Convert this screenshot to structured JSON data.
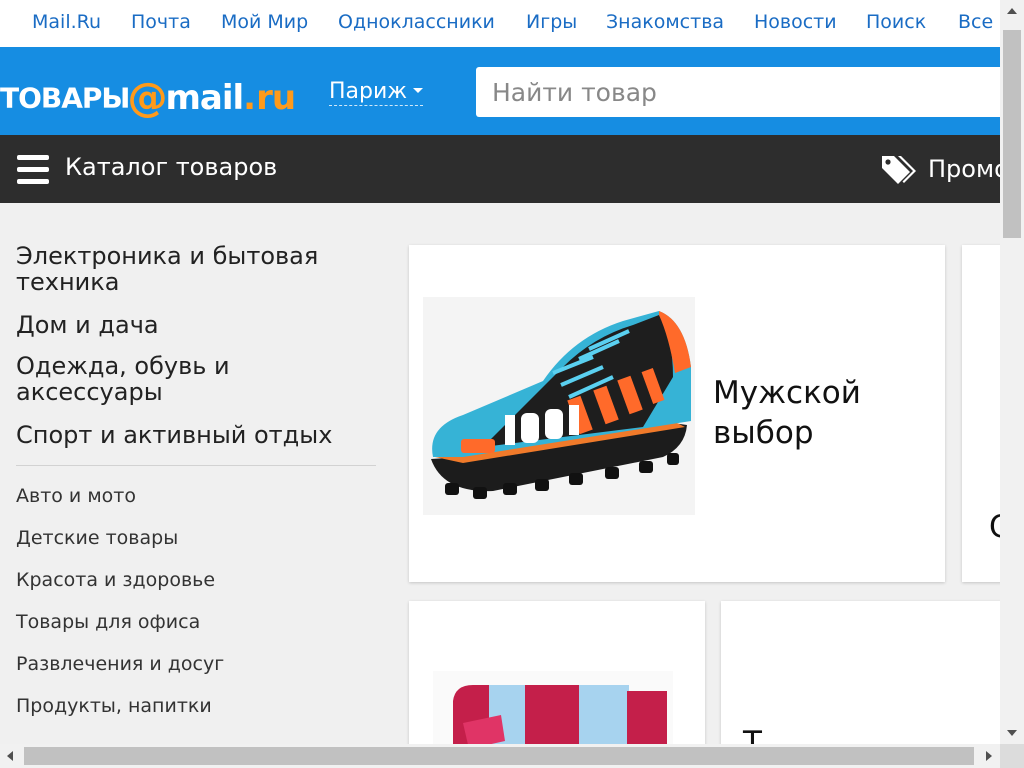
{
  "topnav": {
    "items": [
      "Mail.Ru",
      "Почта",
      "Мой Мир",
      "Одноклассники",
      "Игры",
      "Знакомства",
      "Новости",
      "Поиск",
      "Все"
    ]
  },
  "header": {
    "logo_part1": "ТОВАРЫ",
    "logo_at": "@",
    "logo_part2": "mail",
    "logo_dot": ".",
    "logo_part3": "ru",
    "city": "Париж",
    "search_placeholder": "Найти товар"
  },
  "catbar": {
    "title": "Каталог товаров",
    "promo": "Промо"
  },
  "sidebar": {
    "main_categories": [
      "Электроника и бытовая техника",
      "Дом и дача",
      "Одежда, обувь и аксессуары",
      "Спорт и активный отдых"
    ],
    "sub_categories": [
      "Авто и мото",
      "Детские товары",
      "Красота и здоровье",
      "Товары для офиса",
      "Развлечения и досуг",
      "Продукты, напитки"
    ]
  },
  "cards": {
    "card1_title": "Мужской выбор",
    "card2_partial": "С",
    "card4_partial": "Т"
  },
  "colors": {
    "brand_blue": "#168de2",
    "brand_orange": "#ff9a1a",
    "link_blue": "#1a6cc4",
    "catbar_dark": "#2d2d2d"
  }
}
